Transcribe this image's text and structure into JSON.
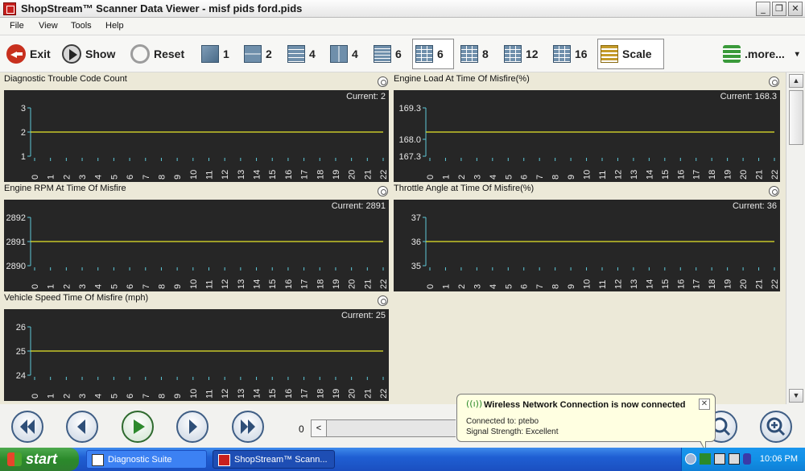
{
  "window": {
    "title": "ShopStream™ Scanner Data Viewer - misf pids ford.pids",
    "minimize": "_",
    "maximize": "❐",
    "close": "✕"
  },
  "menu": [
    "File",
    "View",
    "Tools",
    "Help"
  ],
  "toolbar": {
    "exit": "Exit",
    "show": "Show",
    "reset": "Reset",
    "layouts": [
      "1",
      "2",
      "4",
      "4",
      "6",
      "6",
      "8",
      "12",
      "16"
    ],
    "scale": "Scale",
    "more": ".more...",
    "more_arrow": "▾"
  },
  "panels": [
    {
      "title": "Diagnostic Trouble Code Count",
      "current": "Current: 2",
      "yticks": [
        "3",
        "2",
        "1"
      ],
      "chart_data": {
        "type": "line",
        "x": [
          0,
          1,
          2,
          3,
          4,
          5,
          6,
          7,
          8,
          9,
          10,
          11,
          12,
          13,
          14,
          15,
          16,
          17,
          18,
          19,
          20,
          21,
          22
        ],
        "y_value": 2,
        "ylim": [
          1,
          3
        ]
      }
    },
    {
      "title": "Engine Load At Time Of Misfire(%)",
      "current": "Current: 168.3",
      "yticks": [
        "169.3",
        "168.0",
        "167.3"
      ],
      "chart_data": {
        "type": "line",
        "x": [
          0,
          1,
          2,
          3,
          4,
          5,
          6,
          7,
          8,
          9,
          10,
          11,
          12,
          13,
          14,
          15,
          16,
          17,
          18,
          19,
          20,
          21,
          22
        ],
        "y_value": 168.3,
        "ylim": [
          167.3,
          169.3
        ]
      }
    },
    {
      "title": "Engine RPM At Time Of Misfire",
      "current": "Current: 2891",
      "yticks": [
        "2892",
        "2891",
        "2890"
      ],
      "chart_data": {
        "type": "line",
        "x": [
          0,
          1,
          2,
          3,
          4,
          5,
          6,
          7,
          8,
          9,
          10,
          11,
          12,
          13,
          14,
          15,
          16,
          17,
          18,
          19,
          20,
          21,
          22
        ],
        "y_value": 2891,
        "ylim": [
          2890,
          2892
        ]
      }
    },
    {
      "title": "Throttle Angle at Time Of Misfire(%)",
      "current": "Current: 36",
      "yticks": [
        "37",
        "36",
        "35"
      ],
      "chart_data": {
        "type": "line",
        "x": [
          0,
          1,
          2,
          3,
          4,
          5,
          6,
          7,
          8,
          9,
          10,
          11,
          12,
          13,
          14,
          15,
          16,
          17,
          18,
          19,
          20,
          21,
          22
        ],
        "y_value": 36,
        "ylim": [
          35,
          37
        ]
      }
    },
    {
      "title": "Vehicle Speed Time Of Misfire (mph)",
      "current": "Current: 25",
      "yticks": [
        "26",
        "25",
        "24"
      ],
      "chart_data": {
        "type": "line",
        "x": [
          0,
          1,
          2,
          3,
          4,
          5,
          6,
          7,
          8,
          9,
          10,
          11,
          12,
          13,
          14,
          15,
          16,
          17,
          18,
          19,
          20,
          21,
          22
        ],
        "y_value": 25,
        "ylim": [
          24,
          26
        ]
      }
    }
  ],
  "colors": {
    "chart_bg": "#262626",
    "trace": "#e6e62a",
    "axis": "#5ec8d8",
    "text": "#e8e8e8"
  },
  "scroll": {
    "up": "▲",
    "down": "▼"
  },
  "playback": {
    "slider_value": "0",
    "slider_left": "<"
  },
  "notification": {
    "icon": "((ı))",
    "title": "Wireless Network Connection is now connected",
    "close": "✕",
    "line1": "Connected to: ptebo",
    "line2": "Signal Strength: Excellent"
  },
  "taskbar": {
    "start": "start",
    "tasks": [
      "Diagnostic Suite",
      "ShopStream™ Scann..."
    ],
    "clock": "10:06 PM"
  }
}
